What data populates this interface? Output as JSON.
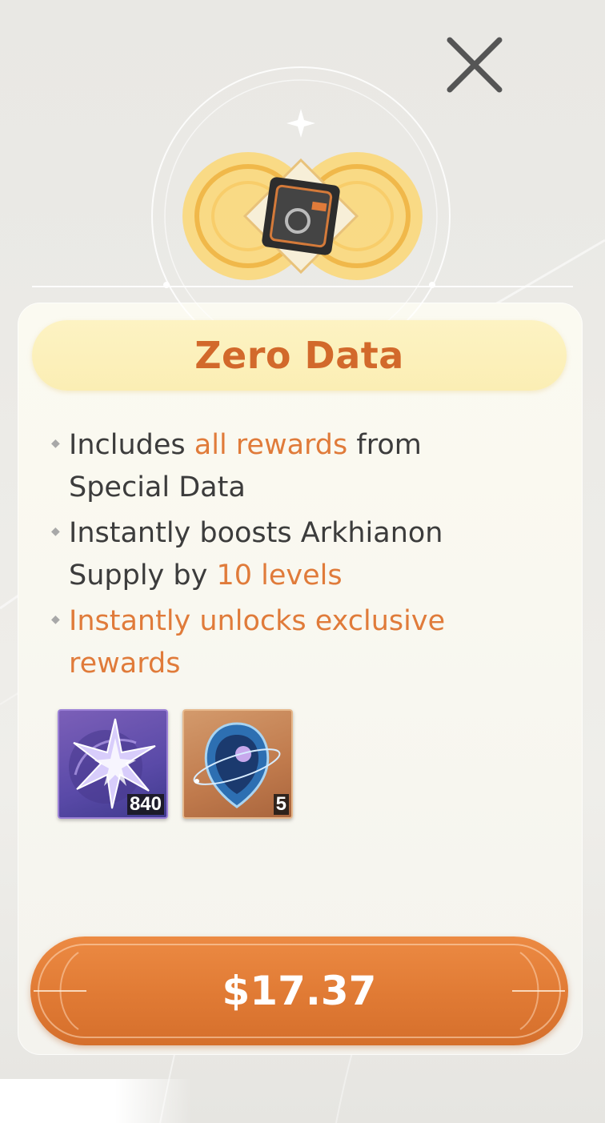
{
  "colors": {
    "accent": "#e07b3a",
    "title_bar": "#fbeeb4",
    "button": "#e07a34",
    "text": "#3c3c3c"
  },
  "header": {
    "close_icon": "close-x-icon",
    "emblem_icon": "data-chip-emblem-icon"
  },
  "panel": {
    "title": "Zero Data",
    "bullets": [
      {
        "line1_pre": "Includes ",
        "line1_hl": "all rewards",
        "line1_post": " from",
        "line2": "Special Data"
      },
      {
        "line1": "Instantly boosts Arkhianon",
        "line2_pre": "Supply by ",
        "line2_hl": "10 levels"
      },
      {
        "line1": "Instantly unlocks exclusive",
        "line2": "rewards"
      }
    ],
    "rewards": [
      {
        "icon": "crystal-star-icon",
        "quantity": "840"
      },
      {
        "icon": "orbit-gem-icon",
        "quantity": "5"
      }
    ]
  },
  "purchase": {
    "price_label": "$17.37"
  }
}
